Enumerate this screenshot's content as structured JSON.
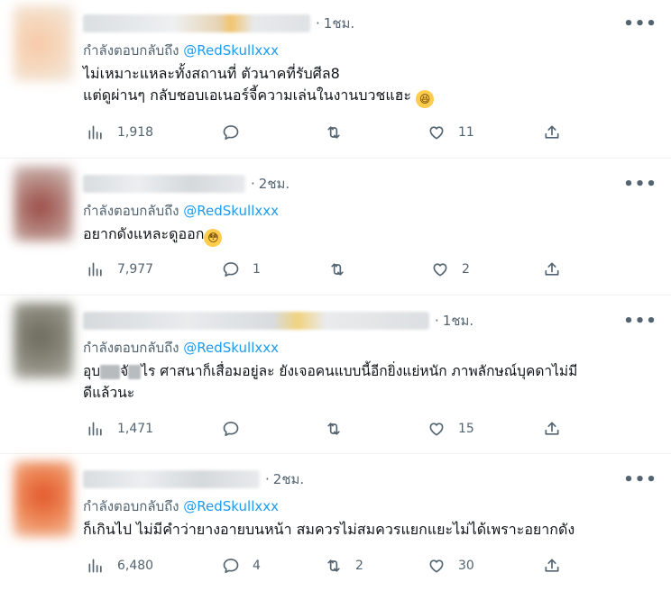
{
  "reply_prefix": "กำลังตอบกลับถึง",
  "tweets": [
    {
      "time": "1ชม.",
      "handle": "@RedSkullxxx",
      "line1": "ไม่เหมาะแหละทั้งสถานที่ ตัวนาคที่รับศีล8",
      "line2": "แต่ดูผ่านๆ กลับชอบเอเนอร์จี้ความเล่นในงานบวชแฮะ",
      "emoji": "😆",
      "views": "1,918",
      "replies": "",
      "retweets": "",
      "likes": "11"
    },
    {
      "time": "2ชม.",
      "handle": "@RedSkullxxx",
      "line1": "อยากดังแหละดูออก",
      "emoji": "😳",
      "views": "7,977",
      "replies": "1",
      "retweets": "",
      "likes": "2"
    },
    {
      "time": "1ชม.",
      "handle": "@RedSkullxxx",
      "line1a": "อุบ",
      "line1b": "จั",
      "line1c": "ไร ศาสนาก็เสื่อมอยู่ละ ยังเจอคนแบบนี้อีกยิ่งแย่หนัก ภาพลักษณ์บุคดาไม่มี",
      "line2": "ดีแล้วนะ",
      "views": "1,471",
      "replies": "",
      "retweets": "",
      "likes": "15"
    },
    {
      "time": "2ชม.",
      "handle": "@RedSkullxxx",
      "line1": "ก็เกินไป ไม่มีคำว่ายางอายบนหน้า สมควรไม่สมควรแยกแยะไม่ได้เพราะอยากดัง",
      "views": "6,480",
      "replies": "4",
      "retweets": "2",
      "likes": "30"
    }
  ],
  "more_icon": "•••",
  "colors": {
    "handle": "#1d9bf0",
    "muted": "#536471",
    "text": "#0f1419",
    "divider": "#eff3f4"
  },
  "icons": [
    "views-icon",
    "reply-icon",
    "retweet-icon",
    "like-icon",
    "share-icon",
    "more-icon"
  ]
}
